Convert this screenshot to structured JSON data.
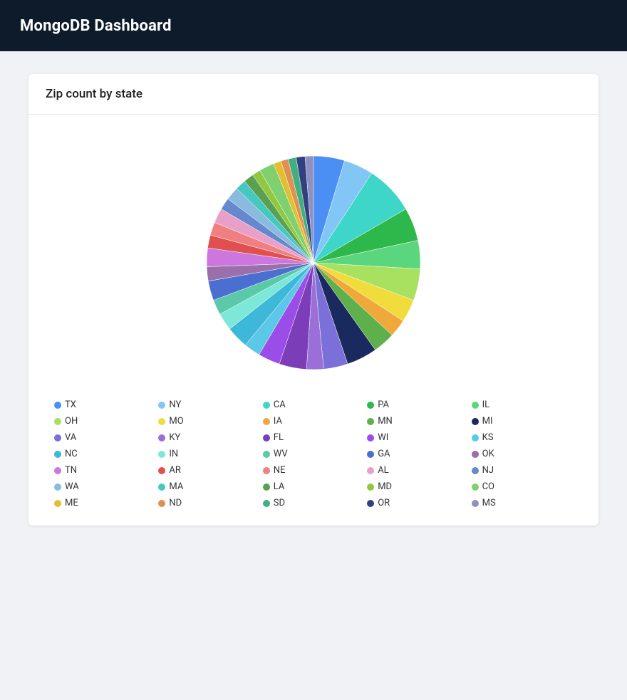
{
  "header": {
    "title": "MongoDB Dashboard"
  },
  "card": {
    "title": "Zip count by state"
  },
  "chart": {
    "slices": [
      {
        "state": "TX",
        "color": "#4B8FF5",
        "value": 1671
      },
      {
        "state": "NY",
        "color": "#82C6F5",
        "value": 1595
      },
      {
        "state": "CA",
        "color": "#3DD6C8",
        "value": 2645
      },
      {
        "state": "PA",
        "color": "#2EB84B",
        "value": 1793
      },
      {
        "state": "IL",
        "color": "#5BD67F",
        "value": 1524
      },
      {
        "state": "OH",
        "color": "#A8E060",
        "value": 1704
      },
      {
        "state": "MO",
        "color": "#F0DC3A",
        "value": 1229
      },
      {
        "state": "IA",
        "color": "#F0A83A",
        "value": 956
      },
      {
        "state": "MN",
        "color": "#5EB04A",
        "value": 1189
      },
      {
        "state": "MI",
        "color": "#1A2A5E",
        "value": 1649
      },
      {
        "state": "VA",
        "color": "#7B6FD8",
        "value": 1303
      },
      {
        "state": "KY",
        "color": "#9B6FD8",
        "value": 914
      },
      {
        "state": "FL",
        "color": "#7B3DB8",
        "value": 1473
      },
      {
        "state": "WI",
        "color": "#9B4DE8",
        "value": 1188
      },
      {
        "state": "KS",
        "color": "#5BC8E8",
        "value": 886
      },
      {
        "state": "NC",
        "color": "#3DB8D8",
        "value": 1190
      },
      {
        "state": "IN",
        "color": "#7DE8D8",
        "value": 942
      },
      {
        "state": "WV",
        "color": "#5BC8A8",
        "value": 813
      },
      {
        "state": "GA",
        "color": "#4B6FD0",
        "value": 1059
      },
      {
        "state": "OK",
        "color": "#9B6FAA",
        "value": 768
      },
      {
        "state": "TN",
        "color": "#CC77DD",
        "value": 1000
      },
      {
        "state": "AR",
        "color": "#E05050",
        "value": 695
      },
      {
        "state": "NE",
        "color": "#F08080",
        "value": 706
      },
      {
        "state": "AL",
        "color": "#E8A0C8",
        "value": 795
      },
      {
        "state": "NJ",
        "color": "#6688CC",
        "value": 646
      },
      {
        "state": "WA",
        "color": "#88BBDD",
        "value": 719
      },
      {
        "state": "MA",
        "color": "#44C8C0",
        "value": 572
      },
      {
        "state": "LA",
        "color": "#5BA050",
        "value": 545
      },
      {
        "state": "MD",
        "color": "#90C840",
        "value": 456
      },
      {
        "state": "CO",
        "color": "#80D070",
        "value": 806
      },
      {
        "state": "ME",
        "color": "#E0C030",
        "value": 414
      },
      {
        "state": "ND",
        "color": "#E09050",
        "value": 392
      },
      {
        "state": "SD",
        "color": "#40B080",
        "value": 437
      },
      {
        "state": "OR",
        "color": "#304080",
        "value": 475
      },
      {
        "state": "MS",
        "color": "#9090C0",
        "value": 451
      }
    ]
  },
  "legend": {
    "rows": [
      [
        {
          "state": "TX",
          "color": "#4B8FF5"
        },
        {
          "state": "NY",
          "color": "#82C6F5"
        },
        {
          "state": "CA",
          "color": "#3DD6C8"
        },
        {
          "state": "PA",
          "color": "#2EB84B"
        },
        {
          "state": "IL",
          "color": "#5BD67F"
        },
        {
          "state": "OH",
          "color": "#A8E060"
        },
        {
          "state": "MO",
          "color": "#F0DC3A"
        },
        {
          "state": "IA",
          "color": "#F0A83A"
        },
        {
          "state": "MN",
          "color": "#5EB04A"
        }
      ],
      [
        {
          "state": "MI",
          "color": "#1A2A5E"
        },
        {
          "state": "VA",
          "color": "#7B6FD8"
        },
        {
          "state": "KY",
          "color": "#9B6FD8"
        },
        {
          "state": "FL",
          "color": "#7B3DB8"
        },
        {
          "state": "WI",
          "color": "#9B4DE8"
        },
        {
          "state": "KS",
          "color": "#5BC8E8"
        },
        {
          "state": "NC",
          "color": "#3DB8D8"
        },
        {
          "state": "IN",
          "color": "#7DE8D8"
        },
        {
          "state": "WV",
          "color": "#5BC8A8"
        }
      ],
      [
        {
          "state": "GA",
          "color": "#4B6FD0"
        },
        {
          "state": "OK",
          "color": "#9B6FAA"
        },
        {
          "state": "TN",
          "color": "#CC77DD"
        },
        {
          "state": "AR",
          "color": "#E05050"
        },
        {
          "state": "NE",
          "color": "#F08080"
        },
        {
          "state": "AL",
          "color": "#E8A0C8"
        },
        {
          "state": "NJ",
          "color": "#6688CC"
        },
        {
          "state": "WA",
          "color": "#88BBDD"
        },
        {
          "state": "MA",
          "color": "#44C8C0"
        }
      ],
      [
        {
          "state": "LA",
          "color": "#5BA050"
        },
        {
          "state": "MD",
          "color": "#90C840"
        },
        {
          "state": "CO",
          "color": "#80D070"
        },
        {
          "state": "ME",
          "color": "#E0C030"
        },
        {
          "state": "ND",
          "color": "#E09050"
        },
        {
          "state": "SD",
          "color": "#40B080"
        },
        {
          "state": "OR",
          "color": "#304080"
        },
        {
          "state": "MS",
          "color": "#9090C0"
        }
      ]
    ]
  }
}
